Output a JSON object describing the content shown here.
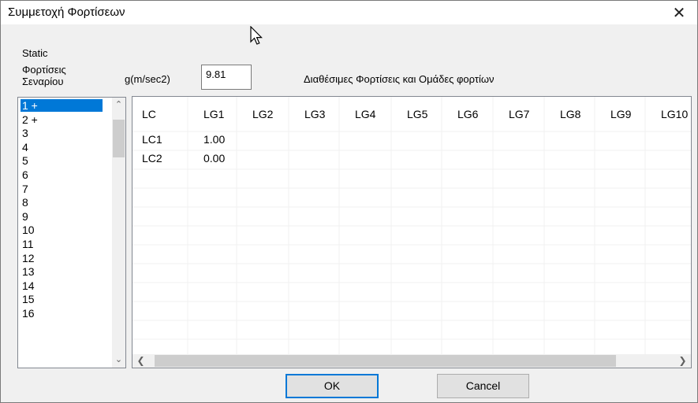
{
  "window": {
    "title": "Συμμετοχή Φορτίσεων",
    "close_icon": "close-icon"
  },
  "labels": {
    "static": "Static",
    "scenario_line1": "Φορτίσεις",
    "scenario_line2": "Σεναρίου",
    "g_label": "g(m/sec2)",
    "available": "Διαθέσιμες Φορτίσεις και Ομάδες φορτίων"
  },
  "g_input": {
    "value": "9.81"
  },
  "scenario_list": {
    "selected_index": 0,
    "items": [
      "1 +",
      "2 +",
      "3",
      "4",
      "5",
      "6",
      "7",
      "8",
      "9",
      "10",
      "11",
      "12",
      "13",
      "14",
      "15",
      "16"
    ]
  },
  "grid": {
    "columns": [
      "LC",
      "LG1",
      "LG2",
      "LG3",
      "LG4",
      "LG5",
      "LG6",
      "LG7",
      "LG8",
      "LG9",
      "LG10"
    ],
    "rows": [
      {
        "lc": "LC1",
        "lg1": "1.00"
      },
      {
        "lc": "LC2",
        "lg1": "0.00"
      }
    ]
  },
  "buttons": {
    "ok": "OK",
    "cancel": "Cancel"
  },
  "colors": {
    "selection": "#0078d7",
    "focus_border": "#0078d7"
  }
}
